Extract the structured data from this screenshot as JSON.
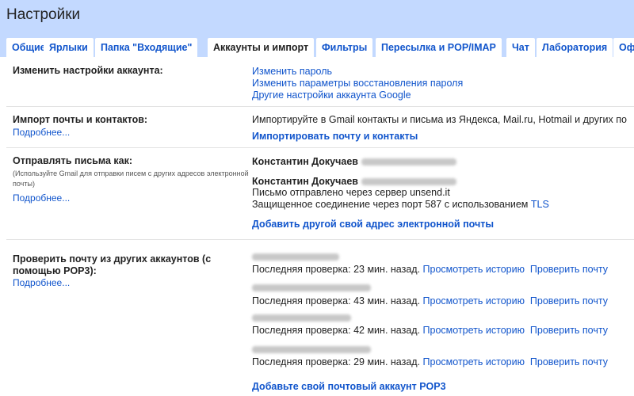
{
  "header": {
    "title": "Настройки"
  },
  "tabs": [
    {
      "label": "Общие",
      "active": false
    },
    {
      "label": "Ярлыки",
      "active": false
    },
    {
      "label": "Папка \"Входящие\"",
      "active": false
    },
    {
      "label": "Аккаунты и импорт",
      "active": true
    },
    {
      "label": "Фильтры",
      "active": false
    },
    {
      "label": "Пересылка и POP/IMAP",
      "active": false
    },
    {
      "label": "Чат",
      "active": false
    },
    {
      "label": "Лаборатория",
      "active": false
    },
    {
      "label": "Оф",
      "active": false
    }
  ],
  "account_settings": {
    "label": "Изменить настройки аккаунта:",
    "links": [
      "Изменить пароль",
      "Изменить параметры восстановления пароля",
      "Другие настройки аккаунта Google"
    ]
  },
  "import": {
    "label": "Импорт почты и контактов:",
    "more": "Подробнее...",
    "description": "Импортируйте в Gmail контакты и письма из Яндекса, Mail.ru, Hotmail и других по",
    "action": "Импортировать почту и контакты"
  },
  "send_as": {
    "label": "Отправлять письма как:",
    "note": "(Используйте Gmail для отправки писем с других адресов электронной почты)",
    "more": "Подробнее...",
    "sender1": "Константин Докучаев",
    "sender2": "Константин Докучаев",
    "server_line": "Письмо отправлено через сервер unsend.it",
    "secure_line": "Защищенное соединение через порт 587 с использованием",
    "tls": "TLS",
    "action": "Добавить другой свой адрес электронной почты"
  },
  "pop3": {
    "label": "Проверить почту из других аккаунтов (с помощью POP3):",
    "more": "Подробнее...",
    "accounts": [
      {
        "status": "Последняя проверка: 23 мин. назад.",
        "history": "Просмотреть историю",
        "check": "Проверить почту"
      },
      {
        "status": "Последняя проверка: 43 мин. назад.",
        "history": "Просмотреть историю",
        "check": "Проверить почту"
      },
      {
        "status": "Последняя проверка: 42 мин. назад.",
        "history": "Просмотреть историю",
        "check": "Проверить почту"
      },
      {
        "status": "Последняя проверка: 29 мин. назад.",
        "history": "Просмотреть историю",
        "check": "Проверить почту"
      }
    ],
    "action": "Добавьте свой почтовый аккаунт POP3"
  }
}
